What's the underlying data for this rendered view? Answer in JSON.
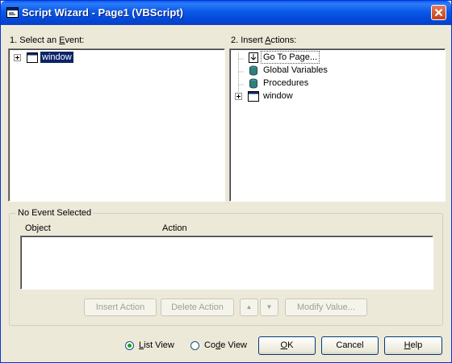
{
  "window": {
    "title": "Script Wizard - Page1 (VBScript)"
  },
  "events": {
    "label_pre": "1. Select an ",
    "label_key": "E",
    "label_post": "vent:",
    "items": [
      {
        "label": "window",
        "icon": "window-icon",
        "expandable": true,
        "selected": true
      }
    ]
  },
  "actions": {
    "label_pre": "2. Insert ",
    "label_key": "A",
    "label_post": "ctions:",
    "items": [
      {
        "label": "Go To Page...",
        "icon": "go-to-page-icon",
        "focused": true
      },
      {
        "label": "Global Variables",
        "icon": "database-icon"
      },
      {
        "label": "Procedures",
        "icon": "database-icon"
      },
      {
        "label": "window",
        "icon": "window-icon",
        "expandable": true
      }
    ]
  },
  "event_group": {
    "title": "No Event Selected",
    "columns": [
      "Object",
      "Action"
    ],
    "rows": []
  },
  "buttons": {
    "insert_action": "Insert Action",
    "delete_action": "Delete Action",
    "move_up": "▲",
    "move_down": "▼",
    "modify_value": "Modify Value..."
  },
  "footer": {
    "list_view": {
      "label_key": "L",
      "label_rest": "ist View",
      "checked": true
    },
    "code_view": {
      "label_pre": "Co",
      "label_key": "d",
      "label_post": "e View",
      "checked": false
    },
    "ok": {
      "label_key": "O",
      "label_rest": "K"
    },
    "cancel": "Cancel",
    "help": {
      "label_key": "H",
      "label_rest": "elp"
    }
  }
}
